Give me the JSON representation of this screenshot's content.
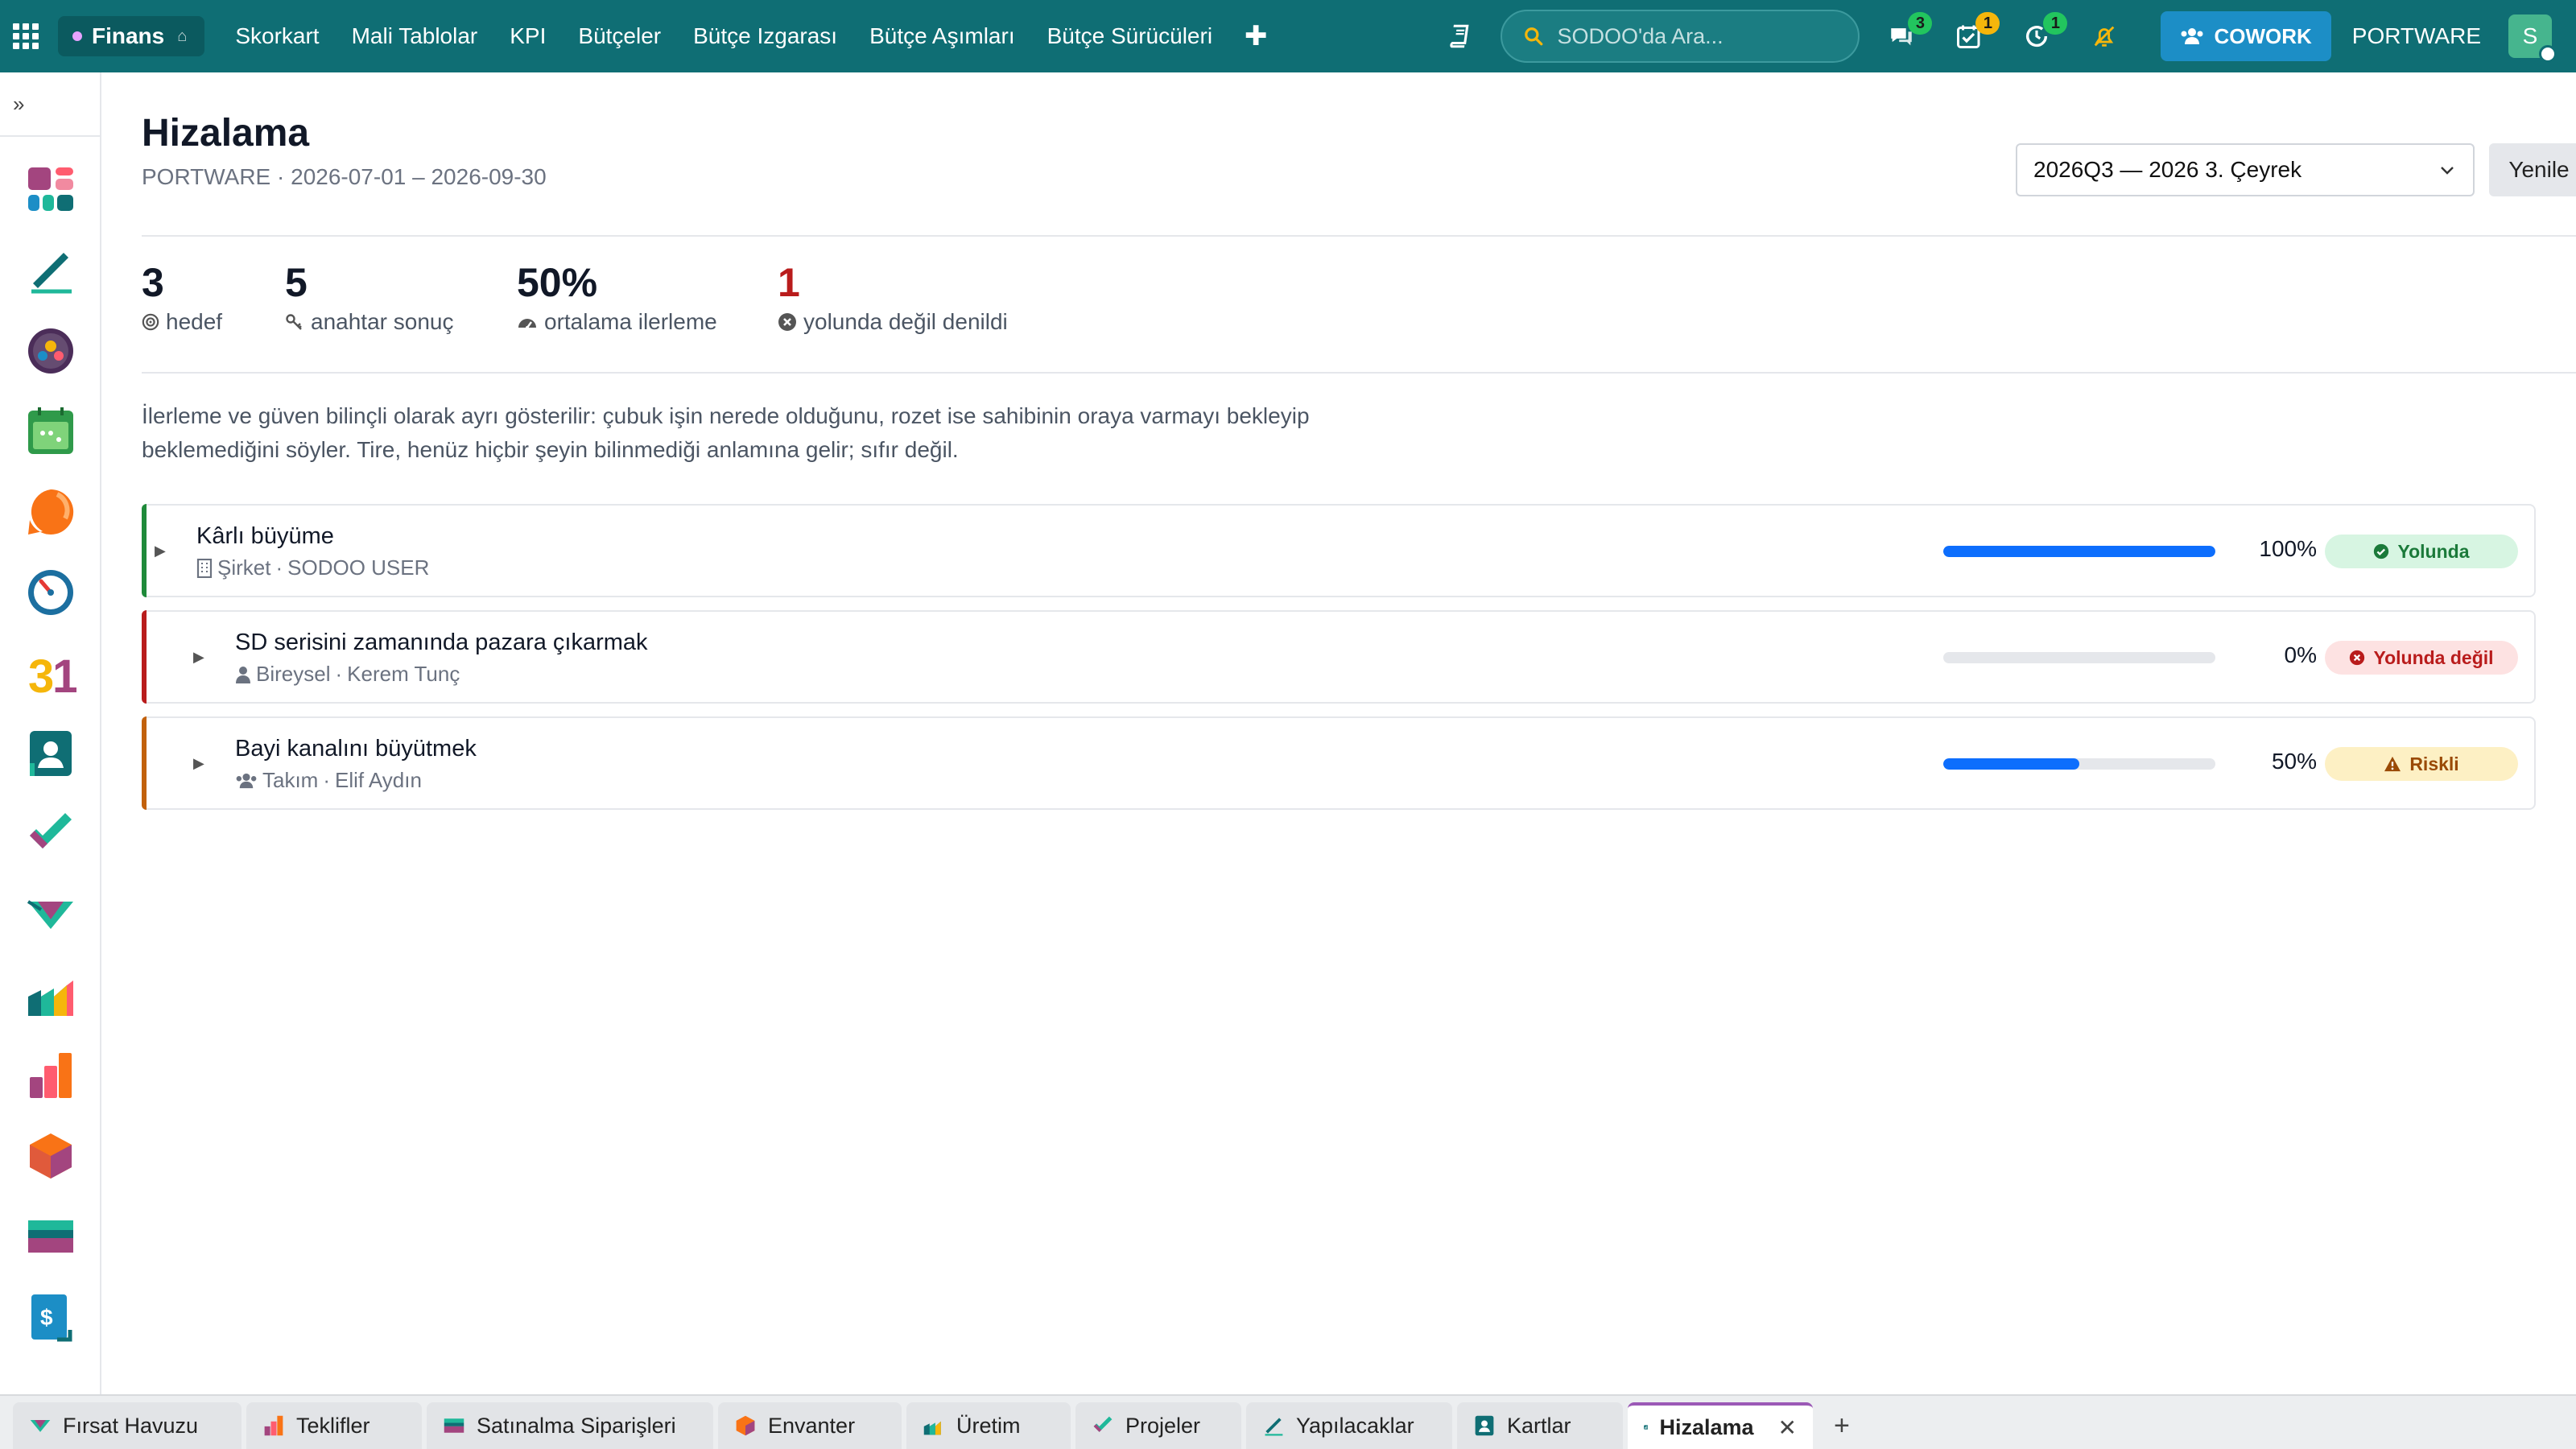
{
  "topbar": {
    "module": "Finans",
    "menu": [
      "Skorkart",
      "Mali Tablolar",
      "KPI",
      "Bütçeler",
      "Bütçe Izgarası",
      "Bütçe Aşımları",
      "Bütçe Sürücüleri"
    ],
    "search_placeholder": "SODOO'da Ara...",
    "badges": {
      "messages": "3",
      "activities": "1",
      "timers": "1"
    },
    "badge_colors": {
      "messages": "#22c55e",
      "activities": "#f5b60b",
      "timers": "#22c55e"
    },
    "cowork_label": "COWORK",
    "company": "PORTWARE",
    "avatar_letter": "S"
  },
  "page": {
    "title": "Hizalama",
    "subtitle": "PORTWARE · 2026-07-01 – 2026-09-30",
    "period": "2026Q3 — 2026 3. Çeyrek",
    "refresh_label": "Yenile"
  },
  "stats": [
    {
      "value": "3",
      "label": "hedef",
      "icon": "target-icon"
    },
    {
      "value": "5",
      "label": "anahtar sonuç",
      "icon": "key-icon"
    },
    {
      "value": "50%",
      "label": "ortalama ilerleme",
      "icon": "gauge-icon"
    },
    {
      "value": "1",
      "label": "yolunda değil denildi",
      "icon": "x-circle-icon",
      "color": "#b91c1c"
    }
  ],
  "description": "İlerleme ve güven bilinçli olarak ayrı gösterilir: çubuk işin nerede olduğunu, rozet ise sahibinin oraya varmayı bekleyip beklemediğini söyler. Tire, henüz hiçbir şeyin bilinmediği anlamına gelir; sıfır değil.",
  "objectives": [
    {
      "title": "Kârlı büyüme",
      "scope": "Şirket",
      "owner": "SODOO USER",
      "scope_icon": "building-icon",
      "progress": 1.0,
      "percent": "100%",
      "status": "Yolunda",
      "status_icon": "check-circle-icon",
      "accent": "#1f8a3a",
      "badge_bg": "#d7f5e2",
      "badge_fg": "#1b7a3a"
    },
    {
      "title": "SD serisini zamanında pazara çıkarmak",
      "scope": "Bireysel",
      "owner": "Kerem Tunç",
      "scope_icon": "user-icon",
      "progress": 0.0,
      "percent": "0%",
      "status": "Yolunda değil",
      "status_icon": "x-circle-icon",
      "accent": "#b91c1c",
      "badge_bg": "#fde2e2",
      "badge_fg": "#b91c1c"
    },
    {
      "title": "Bayi kanalını büyütmek",
      "scope": "Takım",
      "owner": "Elif Aydın",
      "scope_icon": "users-icon",
      "progress": 0.5,
      "percent": "50%",
      "status": "Riskli",
      "status_icon": "warning-icon",
      "accent": "#c2610c",
      "badge_bg": "#fdf0c4",
      "badge_fg": "#9a4a05"
    }
  ],
  "sidebar_apps": [
    "dashboard-app-icon",
    "pen-app-icon",
    "team-app-icon",
    "calendar-app-icon",
    "chat-app-icon",
    "clock-app-icon",
    "date-app-icon",
    "contacts-app-icon",
    "tasks-app-icon",
    "crm-app-icon",
    "manufacturing-app-icon",
    "sales-app-icon",
    "inventory-app-icon",
    "purchase-app-icon",
    "invoice-app-icon"
  ],
  "bottom_tabs": [
    {
      "label": "Fırsat Havuzu",
      "icon": "crm-tab-icon"
    },
    {
      "label": "Teklifler",
      "icon": "sales-tab-icon"
    },
    {
      "label": "Satınalma Siparişleri",
      "icon": "purchase-tab-icon"
    },
    {
      "label": "Envanter",
      "icon": "inventory-tab-icon"
    },
    {
      "label": "Üretim",
      "icon": "manufacturing-tab-icon"
    },
    {
      "label": "Projeler",
      "icon": "projects-tab-icon"
    },
    {
      "label": "Yapılacaklar",
      "icon": "todo-tab-icon"
    },
    {
      "label": "Kartlar",
      "icon": "cards-tab-icon"
    },
    {
      "label": "Hizalama",
      "icon": "alignment-tab-icon",
      "active": true
    }
  ]
}
